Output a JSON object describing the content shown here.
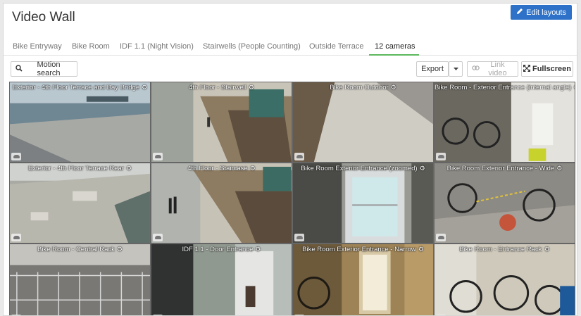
{
  "header": {
    "title": "Video Wall",
    "edit_label": "Edit layouts"
  },
  "tabs": [
    {
      "label": "Bike Entryway"
    },
    {
      "label": "Bike Room"
    },
    {
      "label": "IDF 1.1 (Night Vision)"
    },
    {
      "label": "Stairwells (People Counting)"
    },
    {
      "label": "Outside Terrace"
    },
    {
      "label": "12 cameras"
    }
  ],
  "active_tab": "12 cameras",
  "toolbar": {
    "motion_search_label": "Motion search",
    "export_label": "Export",
    "link_video_label": "Link video",
    "fullscreen_label": "Fullscreen"
  },
  "cameras": [
    {
      "title": "Exterior - 4th Floor Terrace and Bay Bridge"
    },
    {
      "title": "4th Floor - Stairwell"
    },
    {
      "title": "Bike Room Outdoor"
    },
    {
      "title": "Bike Room - Exterior Entrance (internal angle)"
    },
    {
      "title": "Exterior - 4th Floor Terrace Rear"
    },
    {
      "title": "4th Floor - Staircase"
    },
    {
      "title": "Bike Room Exterior Entrance (zoomed)"
    },
    {
      "title": "Bike Room Exterior Entrance - Wide"
    },
    {
      "title": "Bike Room - Central Rack"
    },
    {
      "title": "IDF 1.1 - Door Entrance"
    },
    {
      "title": "Bike Room Exterior Entrance - Narrow"
    },
    {
      "title": "Bike Room - Entrance Rack"
    }
  ],
  "colors": {
    "accent": "#2d72c8",
    "active_tab_underline": "#5cb85c"
  },
  "icons": {
    "edit": "pencil-icon",
    "search": "search-icon",
    "dropdown": "caret-down-icon",
    "link": "link-icon",
    "fullscreen": "fullscreen-icon",
    "camera_settings": "gear-icon",
    "cloud": "cloud-icon"
  }
}
